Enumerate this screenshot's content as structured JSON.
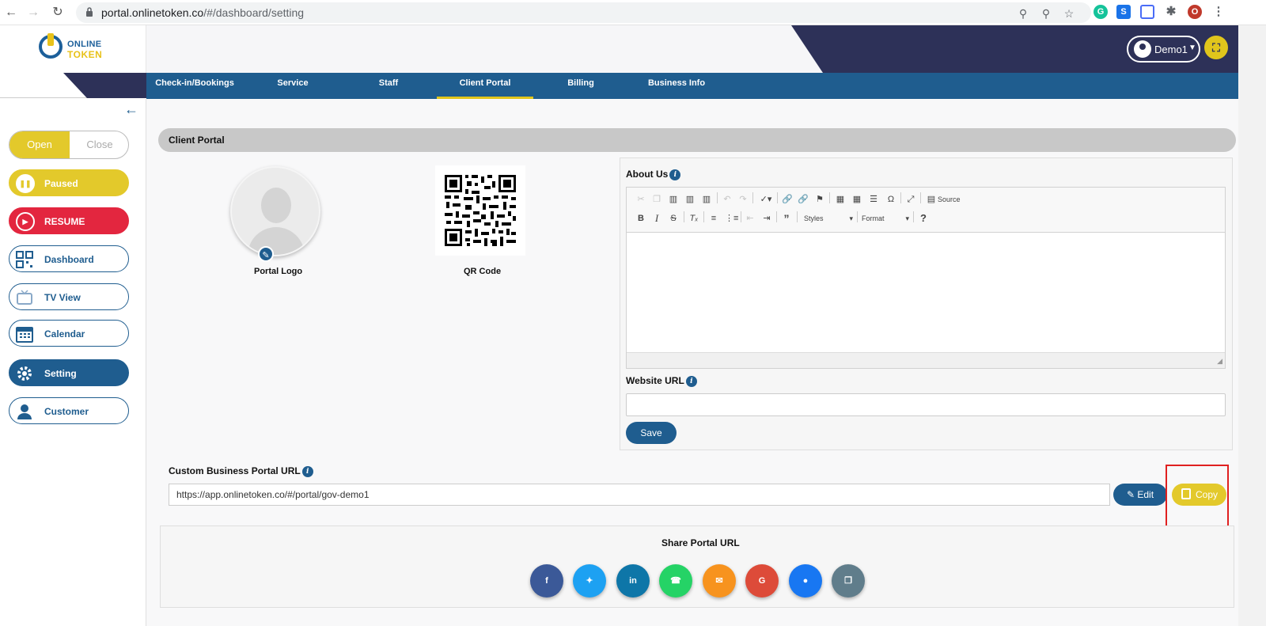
{
  "browser": {
    "url_host": "portal.onlinetoken.co",
    "url_path": "/#/dashboard/setting",
    "profile_initial": "O"
  },
  "brand": {
    "line1": "ONLINE",
    "line2": "TOKEN"
  },
  "header": {
    "user_name": "Demo1"
  },
  "tabs": [
    {
      "label": "Check-in/Bookings"
    },
    {
      "label": "Service"
    },
    {
      "label": "Staff"
    },
    {
      "label": "Client Portal"
    },
    {
      "label": "Billing"
    },
    {
      "label": "Business Info"
    }
  ],
  "sidebar": {
    "toggle_open": "Open",
    "toggle_close": "Close",
    "paused": "Paused",
    "resume": "RESUME",
    "items": [
      {
        "label": "Dashboard"
      },
      {
        "label": "TV View"
      },
      {
        "label": "Calendar"
      },
      {
        "label": "Setting"
      },
      {
        "label": "Customer"
      }
    ]
  },
  "section": {
    "title": "Client Portal"
  },
  "portal": {
    "logo_caption": "Portal Logo",
    "qr_caption": "QR Code",
    "about_label": "About Us",
    "editor": {
      "source_label": "Source",
      "styles_label": "Styles",
      "format_label": "Format"
    },
    "website_label": "Website URL",
    "website_value": "",
    "save_label": "Save",
    "custom_url_label": "Custom Business Portal URL",
    "custom_url_value": "https://app.onlinetoken.co/#/portal/gov-demo1",
    "edit_label": "Edit",
    "copy_label": "Copy",
    "share_title": "Share Portal URL"
  },
  "share_icons": [
    "facebook-icon",
    "twitter-icon",
    "linkedin-icon",
    "whatsapp-icon",
    "email-icon",
    "google-icon",
    "messenger-icon",
    "copy-link-icon"
  ],
  "colors": {
    "brand_blue": "#1f5d8f",
    "brand_dark": "#2d3158",
    "accent_yellow": "#e3c92b",
    "resume_red": "#e3263f"
  }
}
